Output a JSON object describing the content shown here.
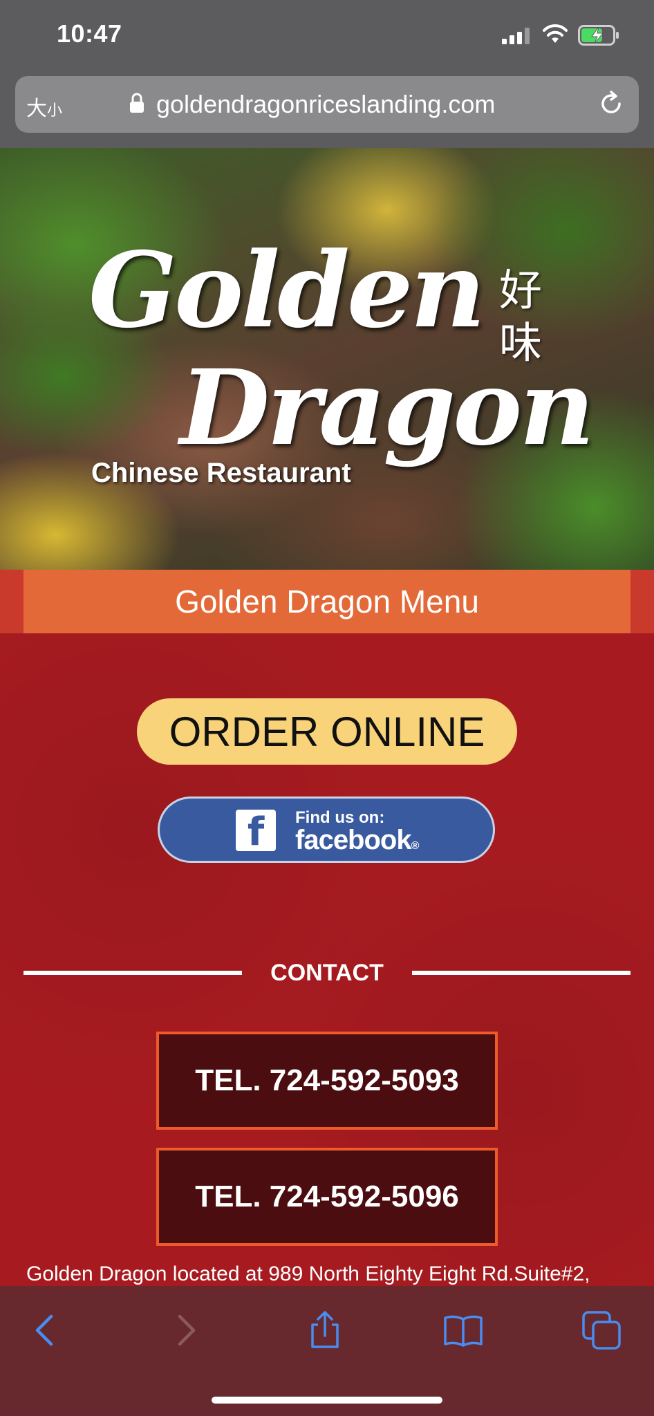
{
  "status_bar": {
    "time": "10:47",
    "icons": [
      "signal-icon",
      "wifi-icon",
      "battery-charging-icon"
    ]
  },
  "browser": {
    "text_size_button_large": "大",
    "text_size_button_small": "小",
    "url": "goldendragonriceslanding.com",
    "icons": [
      "lock-icon",
      "reload-icon"
    ]
  },
  "hero": {
    "logo_line1": "Golden",
    "logo_line2": "Dragon",
    "logo_chinese_line1": "好",
    "logo_chinese_line2": "味",
    "logo_subtitle": "Chinese Restaurant"
  },
  "menu": {
    "label": "Golden Dragon Menu"
  },
  "actions": {
    "order_online": "ORDER ONLINE",
    "facebook_small": "Find us on:",
    "facebook_big": "facebook",
    "facebook_mark": "®",
    "facebook_f": "f"
  },
  "contact": {
    "heading": "CONTACT",
    "phones": [
      "TEL. 724-592-5093",
      "TEL. 724-592-5096"
    ],
    "address_partial": "Golden Dragon located at 989 North Eighty Eight Rd.Suite#2,"
  },
  "toolbar": {
    "icons": [
      "back-icon",
      "forward-icon",
      "share-icon",
      "bookmarks-icon",
      "tabs-icon"
    ]
  },
  "colors": {
    "accent_orange": "#e36a38",
    "order_button": "#f9d37a",
    "facebook_blue": "#3a5a9f",
    "page_red": "#a71b20",
    "tel_border": "#ef5a2a"
  }
}
